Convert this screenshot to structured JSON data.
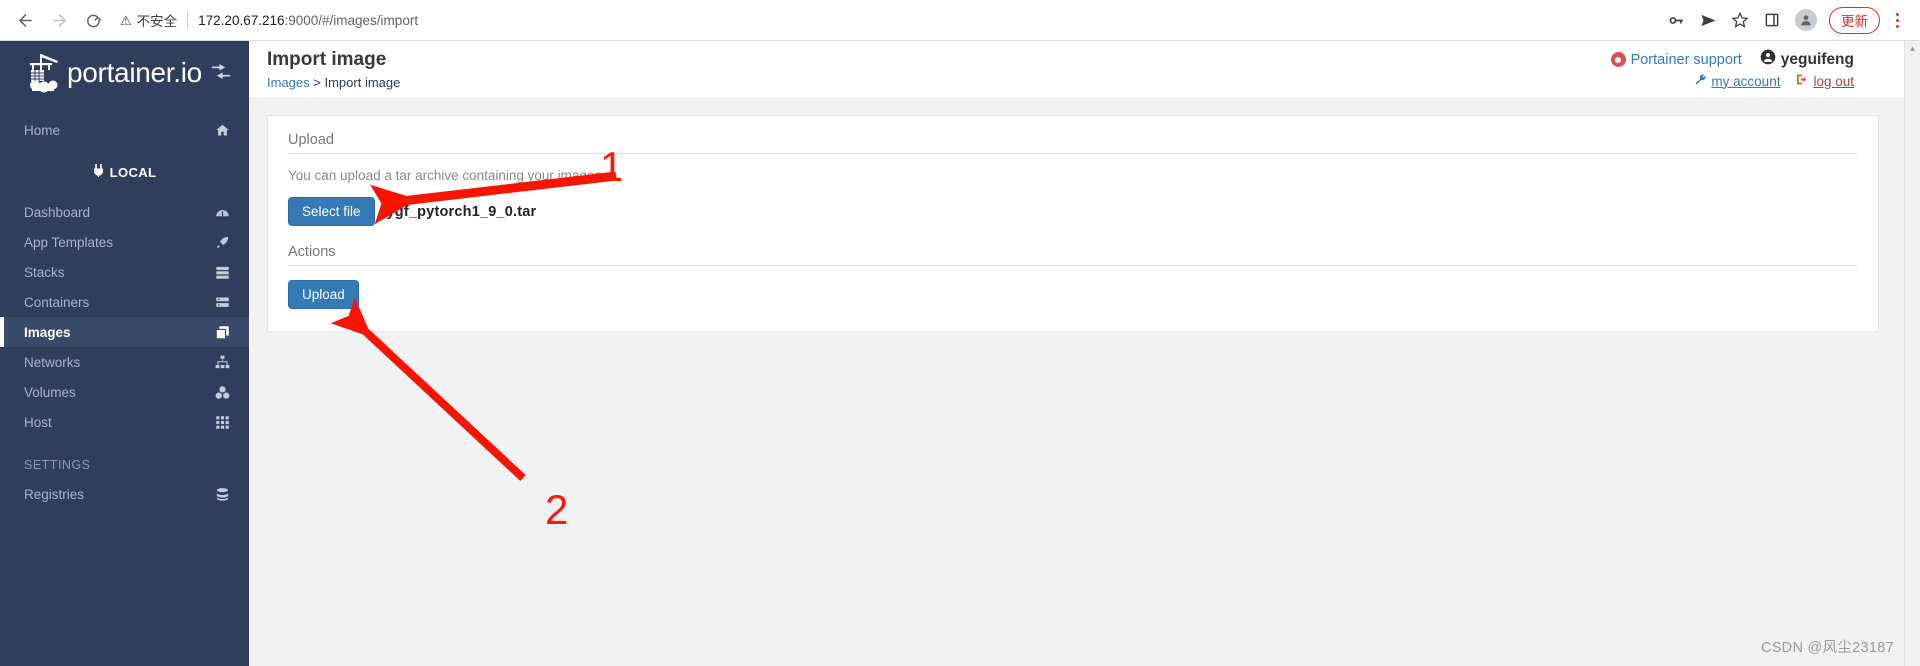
{
  "browser": {
    "back_icon": "back-arrow-icon",
    "forward_icon": "forward-arrow-icon",
    "reload_icon": "reload-icon",
    "security_label": "不安全",
    "url": "172.20.67.216:9000/#/images/import",
    "url_host": "172.20.67.216",
    "url_port_path": ":9000/#/images/import",
    "update_label": "更新",
    "icons": [
      "key-icon",
      "send-icon",
      "star-icon",
      "sidepanel-icon",
      "profile-avatar-icon",
      "menu-kebab-icon"
    ]
  },
  "sidebar": {
    "logo_text": "portainer.io",
    "toggle_icon": "collapse-sidebar-icon",
    "home": {
      "label": "Home",
      "icon": "home-icon"
    },
    "environment": {
      "label": "LOCAL",
      "icon": "plug-icon"
    },
    "items": [
      {
        "label": "Dashboard",
        "icon": "dashboard-icon",
        "active": false
      },
      {
        "label": "App Templates",
        "icon": "rocket-icon",
        "active": false
      },
      {
        "label": "Stacks",
        "icon": "stacks-icon",
        "active": false
      },
      {
        "label": "Containers",
        "icon": "containers-icon",
        "active": false
      },
      {
        "label": "Images",
        "icon": "images-icon",
        "active": true
      },
      {
        "label": "Networks",
        "icon": "networks-icon",
        "active": false
      },
      {
        "label": "Volumes",
        "icon": "volumes-icon",
        "active": false
      },
      {
        "label": "Host",
        "icon": "host-grid-icon",
        "active": false
      }
    ],
    "section_label": "SETTINGS",
    "settings_items": [
      {
        "label": "Registries",
        "icon": "registries-icon",
        "active": false
      }
    ]
  },
  "header": {
    "title": "Import image",
    "breadcrumb_parent": "Images",
    "breadcrumb_sep": ">",
    "breadcrumb_current": "Import image",
    "support_label": "Portainer support",
    "support_icon": "lifering-icon",
    "username": "yeguifeng",
    "user_icon": "user-circle-icon",
    "my_account_label": "my account",
    "my_account_icon": "wrench-icon",
    "logout_label": "log out",
    "logout_icon": "signout-icon"
  },
  "upload": {
    "section_title": "Upload",
    "help_text": "You can upload a tar archive containing your images.",
    "select_file_label": "Select file",
    "file_name": "ygf_pytorch1_9_0.tar"
  },
  "actions": {
    "section_title": "Actions",
    "upload_label": "Upload"
  },
  "annotations": {
    "marker_1": "1",
    "marker_2": "2",
    "arrow_color": "#fa1400"
  },
  "watermark": "CSDN @风尘23187",
  "colors": {
    "sidebar_bg": "#2f3e5d",
    "sidebar_active": "#3a4a6b",
    "primary_button": "#337ab7",
    "link": "#337ab7",
    "danger": "#a94442",
    "page_bg": "#f2f2f2"
  }
}
